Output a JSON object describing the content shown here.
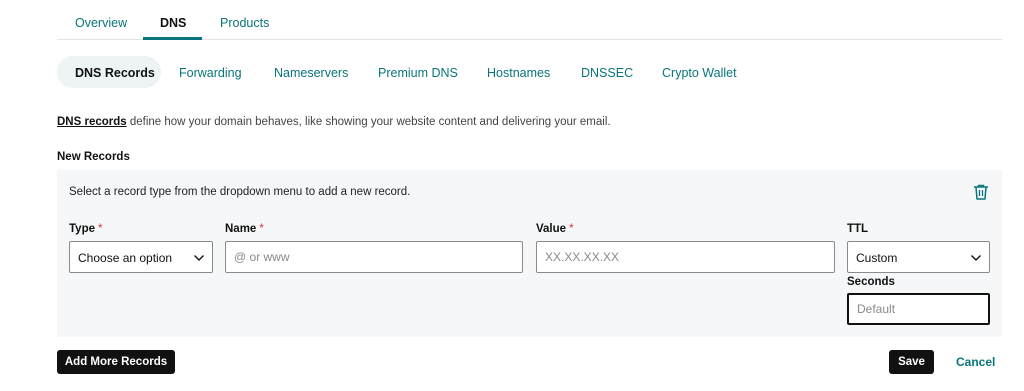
{
  "top_tabs": [
    {
      "label": "Overview",
      "active": false
    },
    {
      "label": "DNS",
      "active": true
    },
    {
      "label": "Products",
      "active": false
    }
  ],
  "sub_tabs": [
    {
      "label": "DNS Records",
      "active": true
    },
    {
      "label": "Forwarding",
      "active": false
    },
    {
      "label": "Nameservers",
      "active": false
    },
    {
      "label": "Premium DNS",
      "active": false
    },
    {
      "label": "Hostnames",
      "active": false
    },
    {
      "label": "DNSSEC",
      "active": false
    },
    {
      "label": "Crypto Wallet",
      "active": false
    }
  ],
  "intro": {
    "link_text": "DNS records",
    "text": " define how your domain behaves, like showing your website content and delivering your email."
  },
  "new_records": {
    "title": "New Records",
    "hint": "Select a record type from the dropdown menu to add a new record.",
    "delete_icon": "trash-icon",
    "type": {
      "label": "Type",
      "required_mark": "*",
      "value": "Choose an option",
      "icon": "chevron-down-icon"
    },
    "name": {
      "label": "Name",
      "required_mark": "*",
      "placeholder": "@ or www"
    },
    "value": {
      "label": "Value",
      "required_mark": "*",
      "placeholder": "XX.XX.XX.XX"
    },
    "ttl": {
      "label": "TTL",
      "value": "Custom",
      "icon": "chevron-down-icon"
    },
    "seconds": {
      "label": "Seconds",
      "placeholder": "Default"
    }
  },
  "actions": {
    "add_more": "Add More Records",
    "save": "Save",
    "cancel": "Cancel"
  },
  "colors": {
    "accent": "#09757a",
    "required": "#d1353c",
    "panel": "#f5f7f8",
    "button": "#111111"
  }
}
